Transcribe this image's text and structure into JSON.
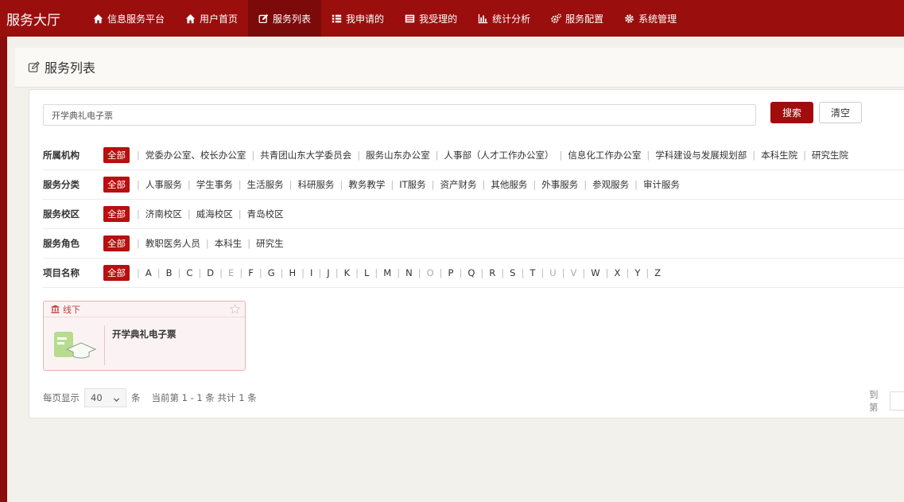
{
  "topbar": {
    "brand": "服务大厅",
    "nav": [
      {
        "label": "信息服务平台",
        "icon": "home-icon",
        "active": false
      },
      {
        "label": "用户首页",
        "icon": "home-icon",
        "active": false
      },
      {
        "label": "服务列表",
        "icon": "edit-icon",
        "active": true
      },
      {
        "label": "我申请的",
        "icon": "list-icon",
        "active": false
      },
      {
        "label": "我受理的",
        "icon": "inbox-icon",
        "active": false
      },
      {
        "label": "统计分析",
        "icon": "bar-chart-icon",
        "active": false
      },
      {
        "label": "服务配置",
        "icon": "cogs-icon",
        "active": false
      },
      {
        "label": "系统管理",
        "icon": "gear-icon",
        "active": false
      }
    ]
  },
  "page": {
    "title": "服务列表",
    "title_icon": "edit-icon"
  },
  "search": {
    "value": "开学典礼电子票",
    "search_label": "搜索",
    "clear_label": "清空"
  },
  "filters": {
    "all_label": "全部",
    "org": {
      "label": "所属机构",
      "options": [
        "党委办公室、校长办公室",
        "共青团山东大学委员会",
        "服务山东办公室",
        "人事部（人才工作办公室）",
        "信息化工作办公室",
        "学科建设与发展规划部",
        "本科生院",
        "研究生院"
      ]
    },
    "category": {
      "label": "服务分类",
      "options": [
        "人事服务",
        "学生事务",
        "生活服务",
        "科研服务",
        "教务教学",
        "IT服务",
        "资产财务",
        "其他服务",
        "外事服务",
        "参观服务",
        "审计服务"
      ]
    },
    "campus": {
      "label": "服务校区",
      "options": [
        "济南校区",
        "威海校区",
        "青岛校区"
      ]
    },
    "role": {
      "label": "服务角色",
      "options": [
        "教职医务人员",
        "本科生",
        "研究生"
      ]
    },
    "project": {
      "label": "项目名称",
      "letters": [
        "A",
        "B",
        "C",
        "D",
        "E",
        "F",
        "G",
        "H",
        "I",
        "J",
        "K",
        "L",
        "M",
        "N",
        "O",
        "P",
        "Q",
        "R",
        "S",
        "T",
        "U",
        "V",
        "W",
        "X",
        "Y",
        "Z"
      ],
      "disabled_letters": [
        "E",
        "O",
        "U",
        "V"
      ]
    }
  },
  "card": {
    "tag": "线下",
    "tag_icon": "bank-icon",
    "title": "开学典礼电子票",
    "image_icon": "graduation-cap-doc-icon",
    "favorite_icon": "star-icon"
  },
  "pager": {
    "prefix": "每页显示",
    "page_size": "40",
    "unit": "条",
    "info": "当前第 1 - 1 条 共计 1 条",
    "goto_label": "到第"
  },
  "colors": {
    "brand": "#9b0e0e",
    "accent": "#b80f0f",
    "card_border": "#e5b4b4"
  }
}
